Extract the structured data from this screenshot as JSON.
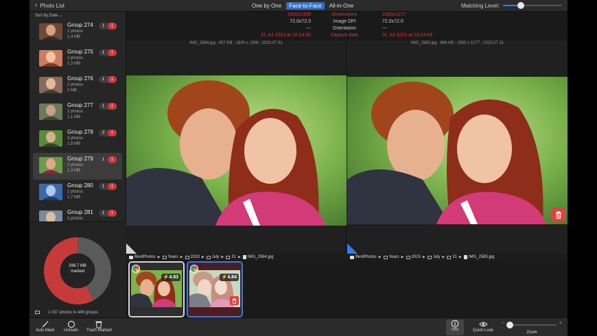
{
  "titlebar": {
    "back_label": "Photo List",
    "modes": [
      {
        "label": "One by One",
        "active": false
      },
      {
        "label": "Face-to-Face",
        "active": true
      },
      {
        "label": "All-in-One",
        "active": false
      }
    ],
    "matching_label": "Matching Level:",
    "matching_level": 0.3
  },
  "sidebar": {
    "sort_label": "Sort by Date",
    "groups": [
      {
        "name": "Group 274",
        "photos": "2 photos",
        "size": "1,4 MB",
        "count": "1",
        "marked": "1"
      },
      {
        "name": "Group 275",
        "photos": "2 photos",
        "size": "1,3 MB",
        "count": "1",
        "marked": "1"
      },
      {
        "name": "Group 276",
        "photos": "2 photos",
        "size": "1 MB",
        "count": "1",
        "marked": "1"
      },
      {
        "name": "Group 277",
        "photos": "2 photos",
        "size": "1,1 MB",
        "count": "1",
        "marked": "1"
      },
      {
        "name": "Group 278",
        "photos": "3 photos",
        "size": "1,9 MB",
        "count": "2",
        "marked": "1"
      },
      {
        "name": "Group 279",
        "photos": "2 photos",
        "size": "1,3 MB",
        "count": "1",
        "marked": "1",
        "selected": true
      },
      {
        "name": "Group 280",
        "photos": "2 photos",
        "size": "1,7 MB",
        "count": "1",
        "marked": "1"
      },
      {
        "name": "Group 281",
        "photos": "2 photos",
        "size": "1,3 MB",
        "count": "1",
        "marked": "1"
      }
    ],
    "donut": {
      "marked_label_1": "298,7 MB",
      "marked_label_2": "marked",
      "marked_fraction": 0.58,
      "marked_color": "#c63a3a",
      "rest_color": "#5a5a5a"
    },
    "summary": "1 037 photos in 449 groups"
  },
  "info": {
    "rows": [
      {
        "left": "1920x1308",
        "label": "Dimensions",
        "right": "1920x1277",
        "highlight": true
      },
      {
        "left": "72.0x72.0",
        "label": "Image DPI",
        "right": "72.0x72.0",
        "highlight": false
      },
      {
        "left": "---",
        "label": "Orientation",
        "right": "---",
        "highlight": false
      },
      {
        "left": "31 Jul 2023 at 10:14:50",
        "label": "Capture date",
        "right": "31 Jul 2023 at 10:14:54",
        "highlight": true
      }
    ]
  },
  "left_pane": {
    "caption": "IMG_2584.jpg : 657 KB : 1920 x 1308 : 2023.07.31",
    "path": [
      "BestPhotos",
      "Years",
      "2023",
      "July",
      "31",
      "IMG_2584.jpg"
    ]
  },
  "right_pane": {
    "caption": "IMG_2585.jpg : 666 KB : 1920 x 1277 : 2023.07.31",
    "path": [
      "BestPhotos",
      "Years",
      "2023",
      "July",
      "31",
      "IMG_2585.jpg"
    ]
  },
  "filmstrip": [
    {
      "score": "4.93"
    },
    {
      "score": "4.84"
    }
  ],
  "toolbar": {
    "auto_mark": "Auto Mark",
    "unmark": "Unmark",
    "trash_marked": "Trash Marked",
    "info": "Info",
    "quick_look": "Quick Look",
    "zoom": "Zoom",
    "zoom_level": 0.05
  },
  "colors": {
    "accent": "#2f6fd2",
    "danger": "#e0423d",
    "highlight_text": "#d23b3b"
  }
}
